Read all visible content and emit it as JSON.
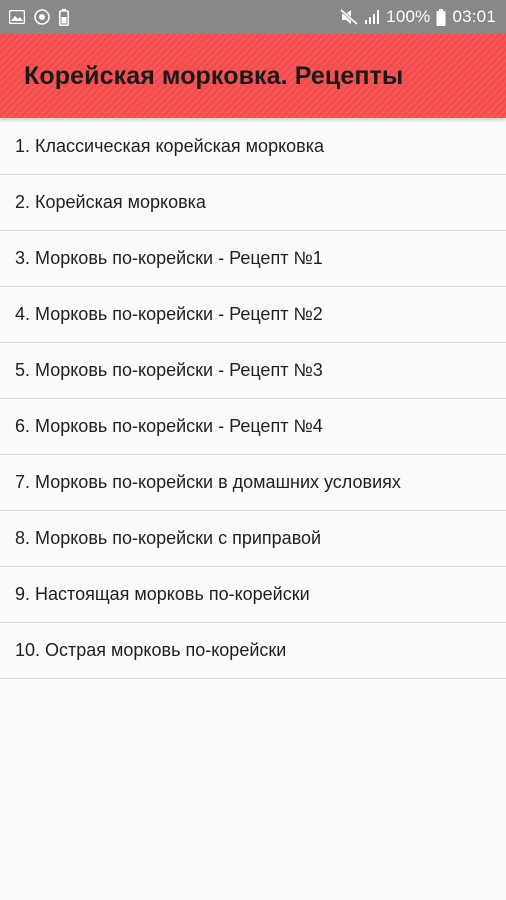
{
  "status_bar": {
    "left_icons": [
      "image-icon",
      "settings-circle-icon",
      "battery-saver-icon"
    ],
    "right_icons": [
      "mute-icon",
      "signal-icon"
    ],
    "battery": "100%",
    "time": "03:01"
  },
  "app_bar": {
    "title": "Корейская морковка. Рецепты",
    "color": "#f44c4c"
  },
  "recipes": [
    "1. Классическая корейская морковка",
    "2. Корейская морковка",
    "3. Морковь по-корейски - Рецепт №1",
    "4. Морковь по-корейски - Рецепт №2",
    "5. Морковь по-корейски - Рецепт №3",
    "6. Морковь по-корейски - Рецепт №4",
    "7. Морковь по-корейски в домашних условиях",
    "8. Морковь по-корейски с приправой",
    "9. Настоящая морковь по-корейски",
    "10. Острая морковь по-корейски"
  ]
}
